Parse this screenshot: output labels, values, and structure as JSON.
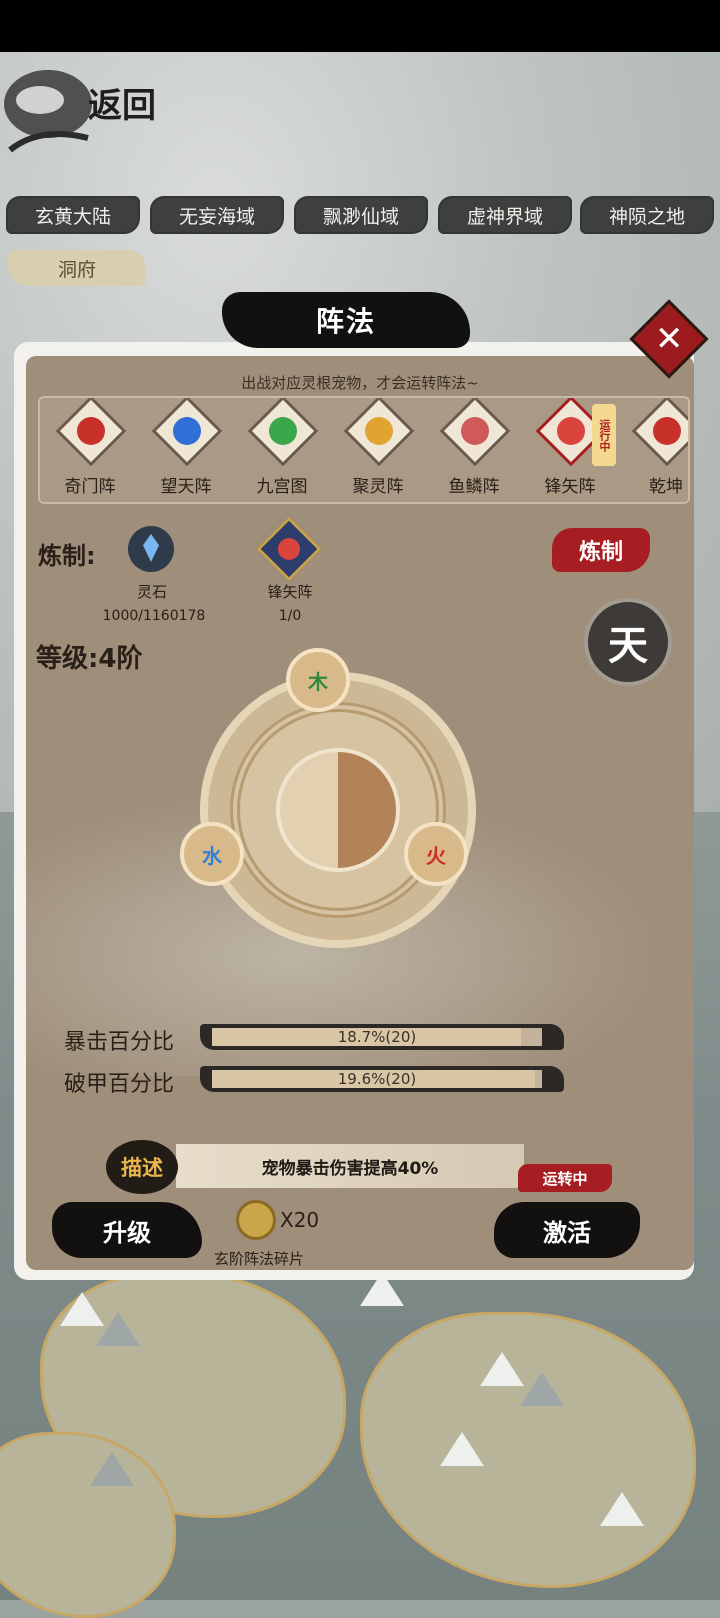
{
  "header": {
    "back_label": "返回"
  },
  "regions": [
    {
      "label": "玄黄大陆"
    },
    {
      "label": "无妄海域"
    },
    {
      "label": "飘渺仙域"
    },
    {
      "label": "虚神界域"
    },
    {
      "label": "神陨之地"
    }
  ],
  "sub_tab": {
    "label": "洞府"
  },
  "panel": {
    "title": "阵法",
    "close_icon": "close-icon",
    "hint": "出战对应灵根宠物，才会运转阵法~",
    "formations": [
      {
        "label": "奇门阵",
        "color": "#c8302a"
      },
      {
        "label": "望天阵",
        "color": "#2f6fd6"
      },
      {
        "label": "九宫图",
        "color": "#3aa84a"
      },
      {
        "label": "聚灵阵",
        "color": "#e0a431"
      },
      {
        "label": "鱼鳞阵",
        "color": "#d05a5a"
      },
      {
        "label": "锋矢阵",
        "color": "#d9453c"
      },
      {
        "label": "乾坤",
        "color": "#c8302a"
      }
    ],
    "running_tag": "运行中",
    "refine": {
      "label": "炼制:",
      "materials": [
        {
          "name": "灵石",
          "count": "1000/1160178",
          "icon": "spirit-stone-icon"
        },
        {
          "name": "锋矢阵",
          "count": "1/0",
          "icon": "formation-fragment-icon"
        }
      ],
      "button": "炼制"
    },
    "level": "等级:4阶",
    "tier_badge": "天",
    "elements": [
      {
        "glyph": "木",
        "color": "#2e8a3a"
      },
      {
        "glyph": "水",
        "color": "#2f80d6"
      },
      {
        "glyph": "火",
        "color": "#d22a22"
      }
    ],
    "stats": [
      {
        "label": "暴击百分比",
        "value": "18.7%(20)",
        "fill": 0.935
      },
      {
        "label": "破甲百分比",
        "value": "19.6%(20)",
        "fill": 0.98
      }
    ],
    "description": {
      "tag": "描述",
      "text": "宠物暴击伤害提高40%"
    },
    "status_tag": "运转中",
    "upgrade_button": "升级",
    "cost": {
      "count": "X20",
      "label": "玄阶阵法碎片",
      "icon": "coin-icon"
    },
    "activate_button": "激活"
  }
}
